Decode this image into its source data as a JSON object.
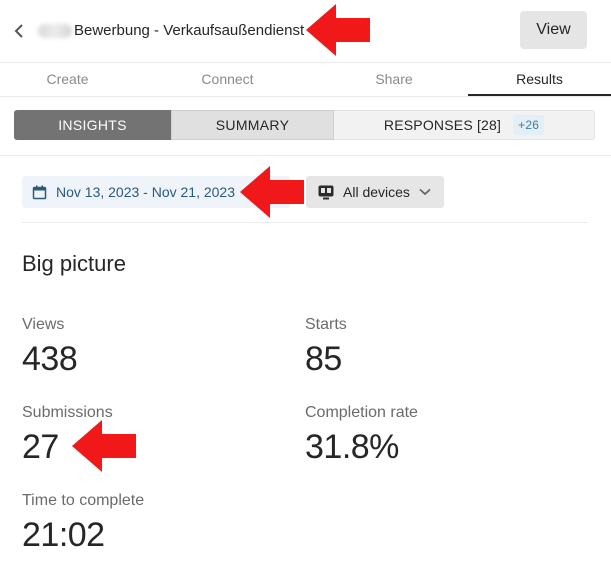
{
  "header": {
    "title": "Bewerbung - Verkaufsaußendienst",
    "view_label": "View"
  },
  "tabs": [
    {
      "label": "Create",
      "active": false
    },
    {
      "label": "Connect",
      "active": false
    },
    {
      "label": "Share",
      "active": false
    },
    {
      "label": "Results",
      "active": true
    }
  ],
  "subtabs": {
    "insights": "INSIGHTS",
    "summary": "SUMMARY",
    "responses": "RESPONSES [28]",
    "responses_badge": "+26"
  },
  "filters": {
    "date_range": "Nov 13, 2023 - Nov 21, 2023",
    "devices": "All devices"
  },
  "big_picture": {
    "title": "Big picture",
    "views_label": "Views",
    "views_value": "438",
    "starts_label": "Starts",
    "starts_value": "85",
    "submissions_label": "Submissions",
    "submissions_value": "27",
    "completion_label": "Completion rate",
    "completion_value": "31.8%",
    "time_label": "Time to complete",
    "time_value": "21:02"
  },
  "colors": {
    "annotation_arrow": "#f01818",
    "accent_blue": "#2c5a7a"
  },
  "icons": [
    "chevron-left-icon",
    "calendar-icon",
    "devices-icon",
    "chevron-down-icon",
    "red-arrow-annotation"
  ]
}
